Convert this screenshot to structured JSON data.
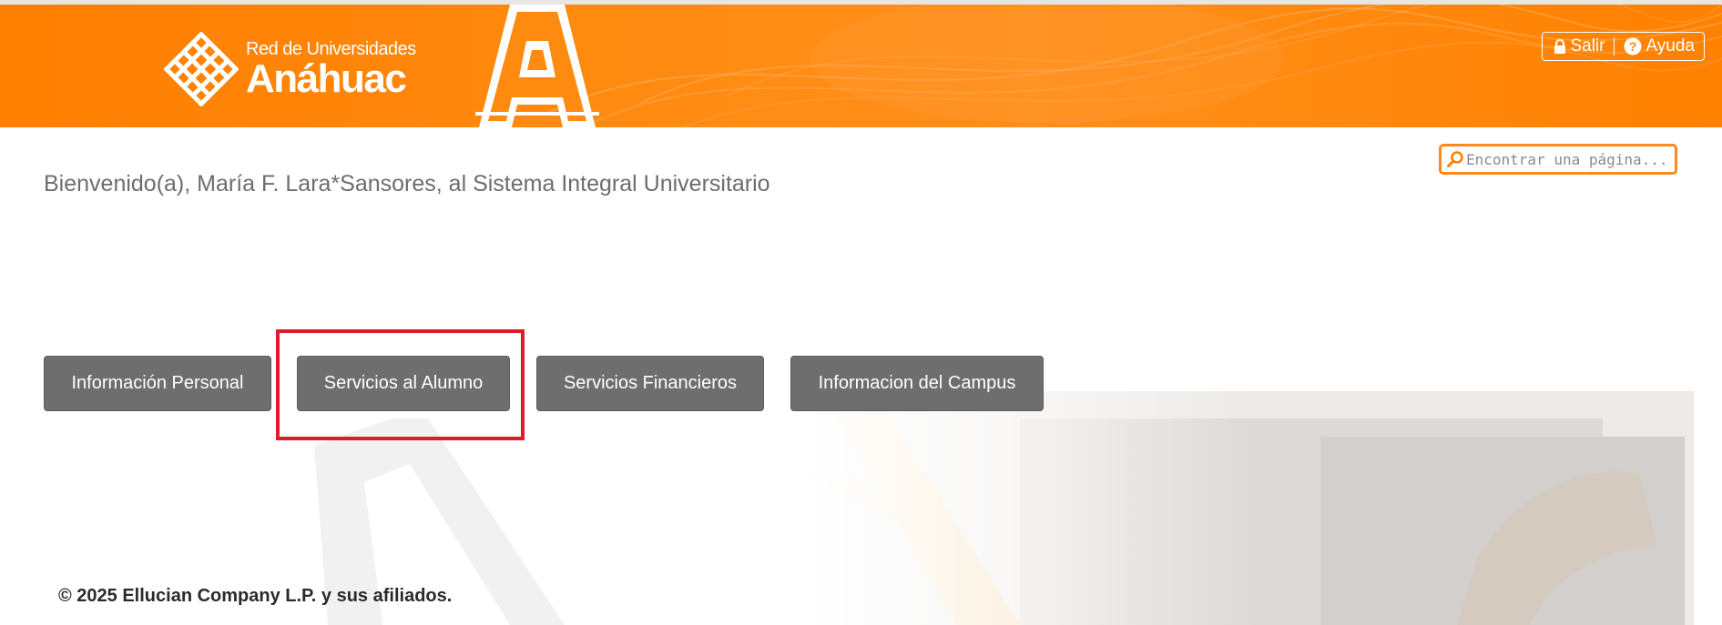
{
  "header": {
    "logo_line1": "Red de Universidades",
    "logo_line2": "Anáhuac",
    "big_letter": "A",
    "links": [
      {
        "label": "Salir",
        "icon": "lock-icon"
      },
      {
        "label": "Ayuda",
        "icon": "help-icon"
      }
    ]
  },
  "search": {
    "placeholder": "Encontrar una página...",
    "value": ""
  },
  "welcome": {
    "text": "Bienvenido(a), María F. Lara*Sansores, al Sistema Integral Universitario"
  },
  "menu": {
    "items": [
      {
        "label": "Información Personal"
      },
      {
        "label": "Servicios al Alumno"
      },
      {
        "label": "Servicios Financieros"
      },
      {
        "label": "Informacion del Campus"
      }
    ]
  },
  "footer": {
    "copyright": "© 2025 Ellucian Company L.P. y sus afiliados."
  },
  "colors": {
    "brand_orange": "#ff8100",
    "button_gray": "#6e6e6e",
    "highlight_red": "#e01b2a"
  }
}
